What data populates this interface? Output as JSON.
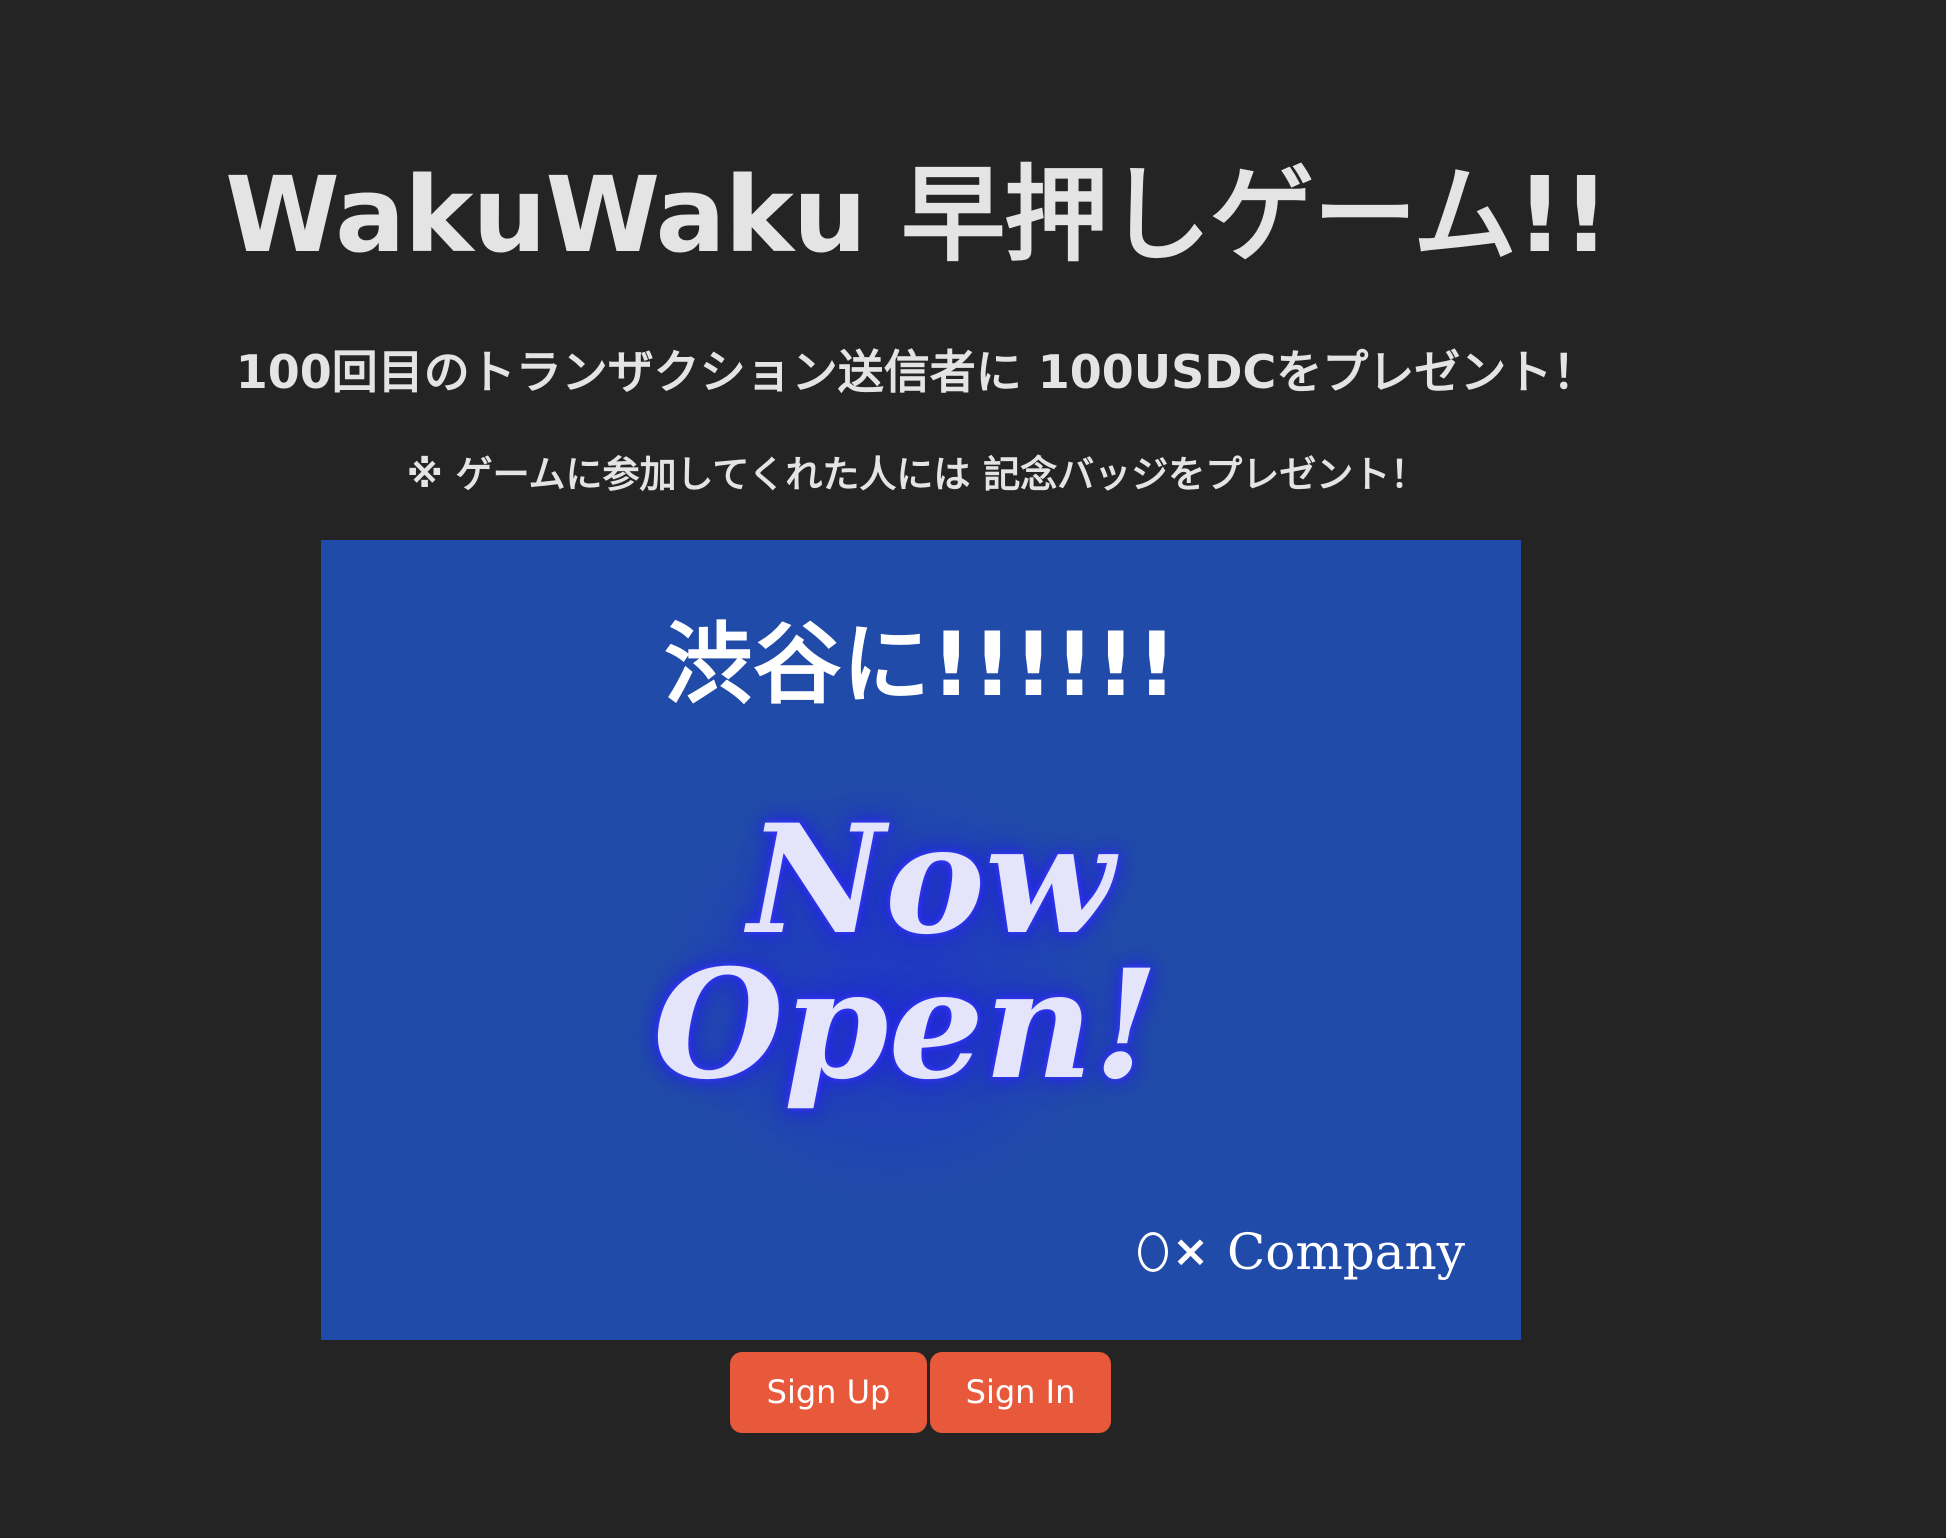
{
  "header": {
    "title": "WakuWaku 早押しゲーム!!",
    "subtitle": "100回目のトランザクション送信者に 100USDCをプレゼント！",
    "note": "※ ゲームに参加してくれた人には 記念バッジをプレゼント！"
  },
  "banner": {
    "heading": "渋谷に!!!!!!",
    "neon_line_1": "Now",
    "neon_line_2": "Open!",
    "brand_mark": "〇×",
    "brand_name": "Company"
  },
  "actions": {
    "sign_up_label": "Sign Up",
    "sign_in_label": "Sign In"
  },
  "colors": {
    "background": "#242424",
    "text": "#e4e4e4",
    "banner": "#214ba8",
    "button": "#e8583a"
  }
}
